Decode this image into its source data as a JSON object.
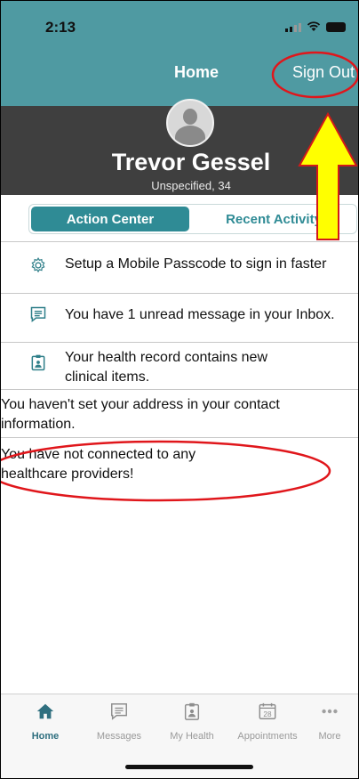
{
  "status_bar": {
    "time": "2:13"
  },
  "header": {
    "title": "Home",
    "sign_out_label": "Sign Out"
  },
  "profile": {
    "name": "Trevor Gessel",
    "subtitle": "Unspecified, 34"
  },
  "tabs": {
    "active": "Action Center",
    "inactive": "Recent Activity"
  },
  "action_items": [
    {
      "icon": "gear-icon",
      "text": "Setup a Mobile Passcode to sign in faster"
    },
    {
      "icon": "message-icon",
      "text": "You have 1 unread message in your Inbox."
    },
    {
      "icon": "health-record-icon",
      "text": "Your health record contains new clinical items."
    },
    {
      "icon": "",
      "text": "You haven't set your address in your contact information."
    },
    {
      "icon": "",
      "text": "You have not connected to any healthcare providers!"
    }
  ],
  "tab_bar": [
    {
      "icon": "home-icon",
      "label": "Home"
    },
    {
      "icon": "messages-icon",
      "label": "Messages"
    },
    {
      "icon": "clipboard-icon",
      "label": "My Health"
    },
    {
      "icon": "calendar-icon",
      "label": "Appointments",
      "calendar_day": "28"
    },
    {
      "icon": "more-icon",
      "label": "More"
    }
  ],
  "colors": {
    "header": "#4f9aa2",
    "profile_bg": "#3f3f3f",
    "accent": "#2f8b95",
    "annotation_red": "#e0161b",
    "annotation_arrow": "#ffff00"
  }
}
